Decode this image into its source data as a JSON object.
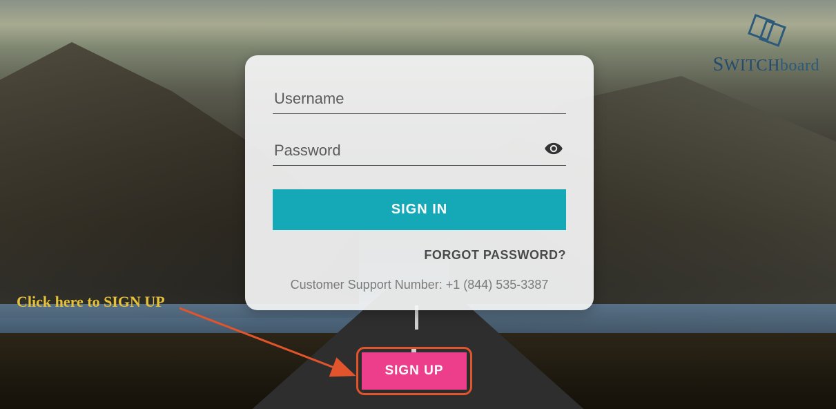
{
  "brand": {
    "name_part1": "S",
    "name_part2": "WITCH",
    "name_part3": "board"
  },
  "login": {
    "username_placeholder": "Username",
    "username_value": "",
    "password_placeholder": "Password",
    "password_value": "",
    "signin_label": "SIGN IN",
    "forgot_label": "FORGOT PASSWORD?",
    "support_text": "Customer Support Number: +1 (844) 535-3387",
    "signup_label": "SIGN UP"
  },
  "annotation": {
    "callout_text": "Click here to SIGN UP"
  }
}
